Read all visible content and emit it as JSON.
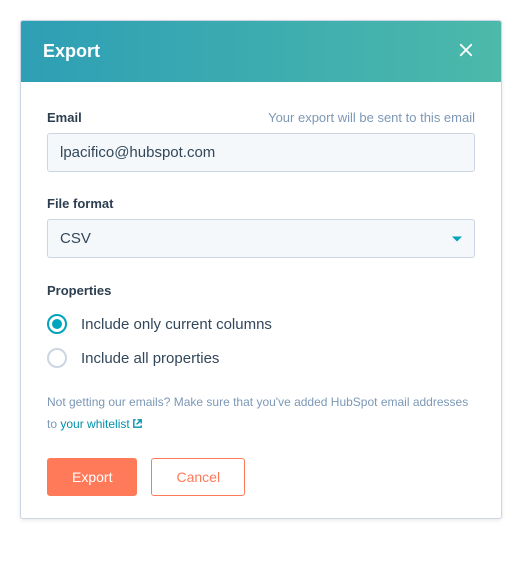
{
  "header": {
    "title": "Export"
  },
  "email": {
    "label": "Email",
    "helper": "Your export will be sent to this email",
    "value": "lpacifico@hubspot.com"
  },
  "file_format": {
    "label": "File format",
    "value": "CSV"
  },
  "properties": {
    "label": "Properties",
    "options": [
      {
        "label": "Include only current columns",
        "selected": true
      },
      {
        "label": "Include all properties",
        "selected": false
      }
    ]
  },
  "help": {
    "prefix": "Not getting our emails? Make sure that you've added HubSpot email addresses to ",
    "link_text": "your whitelist"
  },
  "buttons": {
    "export": "Export",
    "cancel": "Cancel"
  }
}
